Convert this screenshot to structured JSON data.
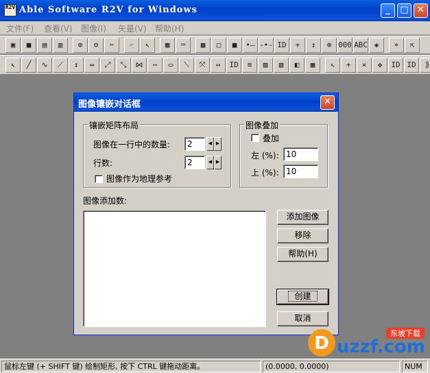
{
  "window": {
    "title": "Able Software R2V for Windows",
    "icon_text": "R2V",
    "icon": "app-icon"
  },
  "title_buttons": {
    "minimize": "_",
    "maximize": "□",
    "close": "✕"
  },
  "menu": [
    {
      "label": "文件(F)"
    },
    {
      "label": "查看(V)"
    },
    {
      "label": "图像(I)"
    },
    {
      "label": "矢量(V)"
    },
    {
      "label": "帮助(H)"
    }
  ],
  "toolbar1": [
    {
      "name": "open-icon",
      "glyph": "▣"
    },
    {
      "name": "save-icon",
      "glyph": "■"
    },
    {
      "name": "save-image-icon",
      "glyph": "▤"
    },
    {
      "name": "save-vector-icon",
      "glyph": "▥"
    },
    {
      "name": "zoom-in-icon",
      "glyph": "⊕"
    },
    {
      "name": "zoom-out-icon",
      "glyph": "⊖"
    },
    {
      "name": "cut-icon",
      "glyph": "✂"
    },
    {
      "name": "undo-icon",
      "glyph": "↶"
    },
    {
      "name": "select-arrow-icon",
      "glyph": "↖"
    },
    {
      "name": "grid-icon",
      "glyph": "▦"
    },
    {
      "name": "keyboard-icon",
      "glyph": "⌨"
    },
    {
      "name": "fit-icon",
      "glyph": "▩"
    },
    {
      "name": "frame-icon",
      "glyph": "▢"
    },
    {
      "name": "fill-icon",
      "glyph": "■"
    },
    {
      "name": "line-node-icon",
      "glyph": "•—"
    },
    {
      "name": "segment-icon",
      "glyph": "-•-"
    },
    {
      "name": "id-icon",
      "glyph": "ID"
    },
    {
      "name": "cross-icon",
      "glyph": "+"
    },
    {
      "name": "point-id-icon",
      "glyph": "↕"
    },
    {
      "name": "delete-point-icon",
      "glyph": "⊗"
    },
    {
      "name": "ooo-icon",
      "glyph": "000"
    },
    {
      "name": "abc-icon",
      "glyph": "ABC"
    },
    {
      "name": "target-icon",
      "glyph": "◈"
    },
    {
      "name": "measure-icon",
      "glyph": "⌖"
    },
    {
      "name": "pick-icon",
      "glyph": "⇱"
    }
  ],
  "toolbar2": [
    {
      "name": "vector-edit-icon",
      "glyph": "↖"
    },
    {
      "name": "draw-line-icon",
      "glyph": "╱"
    },
    {
      "name": "lasso-icon",
      "glyph": "∿"
    },
    {
      "name": "line-tool-icon",
      "glyph": "⟋"
    },
    {
      "name": "vertical-split-icon",
      "glyph": "↕"
    },
    {
      "name": "horizontal-split-icon",
      "glyph": "↔"
    },
    {
      "name": "node-move-icon",
      "glyph": "⤢"
    },
    {
      "name": "join-icon",
      "glyph": "⤡"
    },
    {
      "name": "break-icon",
      "glyph": "⋈"
    },
    {
      "name": "smooth-icon",
      "glyph": "⋯"
    },
    {
      "name": "rectangle-icon",
      "glyph": "▭"
    },
    {
      "name": "diagonal-icon",
      "glyph": "⟍"
    },
    {
      "name": "expand-icon",
      "glyph": "⤧"
    },
    {
      "name": "hfit-icon",
      "glyph": "⇔"
    },
    {
      "name": "label-id-icon",
      "glyph": "ID"
    },
    {
      "name": "contour-icon",
      "glyph": "≋"
    },
    {
      "name": "hatch-icon",
      "glyph": "▨"
    },
    {
      "name": "hatch2-icon",
      "glyph": "▧"
    },
    {
      "name": "polygon-icon",
      "glyph": "◧"
    },
    {
      "name": "mesh-icon",
      "glyph": "▦"
    },
    {
      "name": "select-add-icon",
      "glyph": "↖"
    },
    {
      "name": "add-point-icon",
      "glyph": "+"
    },
    {
      "name": "remove-point-icon",
      "glyph": "×"
    },
    {
      "name": "move-point-icon",
      "glyph": "✥"
    },
    {
      "name": "node-id-icon",
      "glyph": "ID"
    },
    {
      "name": "vector-id-icon",
      "glyph": "ID"
    },
    {
      "name": "more-icon",
      "glyph": "⟫"
    }
  ],
  "dialog": {
    "title": "图像镶嵌对话框",
    "close": "✕",
    "matrix_group": "镶嵌矩阵布局",
    "per_row_label": "图像在一行中的数量:",
    "per_row_value": "2",
    "rows_label": "行数:",
    "rows_value": "2",
    "georef_label": "图像作为地理参考",
    "overlay_group": "图像叠加",
    "overlay_label": "叠加",
    "left_label": "左 (%):",
    "left_value": "10",
    "top_label": "上 (%):",
    "top_value": "10",
    "list_label": "图像添加数:",
    "add_btn": "添加图像",
    "remove_btn": "移除",
    "help_btn": "帮助(H)",
    "create_btn": "创建",
    "cancel_btn": "取消",
    "spin_left": "◀",
    "spin_right": "▶"
  },
  "status": {
    "hint": "鼠标左键 (+ SHIFT 键) 绘制矩形, 按下 CTRL 键拖动距离。",
    "coords": "(0.0000, 0.0000)",
    "num": "NUM"
  },
  "watermark": {
    "text": "uzzf.com",
    "badge": "东坡下载",
    "letter": "D"
  }
}
